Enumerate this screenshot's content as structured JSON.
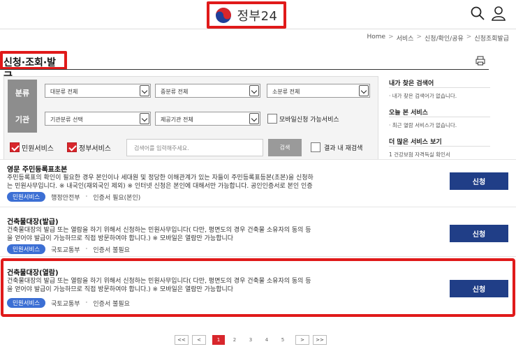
{
  "header": {
    "logo_text": "정부24",
    "search_icon": "search-icon",
    "user_icon": "user-icon"
  },
  "breadcrumb": [
    "Home",
    ">",
    "서비스",
    ">",
    "신청/확인/공유",
    ">",
    "신청조회발급"
  ],
  "page_title": "신청·조회·발급",
  "filter": {
    "row1_label": "분류",
    "row2_label": "기관",
    "major_category": "대분류 전체",
    "mid_category": "중분류 전체",
    "minor_category": "소분류 전체",
    "org_type": "기관분류 선택",
    "provider": "제공기관 전체",
    "mobile_label": "모바일신청 가능서비스",
    "civil_label": "민원서비스",
    "gov_label": "정부서비스",
    "search_placeholder": "검색어를 입력해주세요.",
    "search_button": "검색",
    "research_label": "결과 내 재검색"
  },
  "sidebar": {
    "my_search_title": "내가 찾은 검색어",
    "my_search_empty": "· 내가 찾은 검색어가 없습니다.",
    "today_title": "오늘 본 서비스",
    "today_empty": "· 최근 열람 서비스가 없습니다.",
    "more_title": "더 많은 서비스 보기",
    "more_item": "1  건강보험 자격득실 확인서"
  },
  "results": [
    {
      "title": "영문 주민등록표초본",
      "desc_1": "주민등록표의 확인이 필요한 경우 본인이나 세대원 및 정당한 이해관계가 있는 자들이 주민등록표등본(초본)을 신청하",
      "desc_2": "는 민원사무입니다. ※ 내국인(재외국인 제외) ※ 인터넷 신청은 본인에 대해서만 가능합니다. 공인인증서로 본인 인증",
      "badge": "민원서비스",
      "org": "행정안전부",
      "cert": "인증서 필요(본인)",
      "apply": "신청"
    },
    {
      "title": "건축물대장(발급)",
      "desc_1": "건축물대장의 발급 또는 열람을 하기 위해서 신청하는 민원사무입니다( 다만, 평면도의 경우 건축물 소유자의 동의 등",
      "desc_2": "을 얻어야 발급이 가능하므로 직접 방문하여야 합니다.) ※ 모바일은 열람만 가능합니다",
      "badge": "민원서비스",
      "org": "국토교통부",
      "cert": "인증서 불필요",
      "apply": "신청"
    },
    {
      "title": "건축물대장(열람)",
      "desc_1": "건축물대장의 발급 또는 열람을 하기 위해서 신청하는 민원사무입니다( 다만, 평면도의 경우 건축물 소유자의 동의 등",
      "desc_2": "을 얻어야 발급이 가능하므로 직접 방문하여야 합니다.) ※ 모바일은 열람만 가능합니다",
      "badge": "민원서비스",
      "org": "국토교통부",
      "cert": "인증서 불필요",
      "apply": "신청"
    }
  ],
  "pagination": {
    "first": "<<",
    "prev": "<",
    "pages": [
      "1",
      "2",
      "3",
      "4",
      "5"
    ],
    "current": "1",
    "next": ">",
    "last": ">>"
  },
  "colors": {
    "highlight": "#e01a1a",
    "apply_button": "#203e87",
    "badge": "#3c6fd4",
    "checkbox_on": "#d8262c"
  }
}
